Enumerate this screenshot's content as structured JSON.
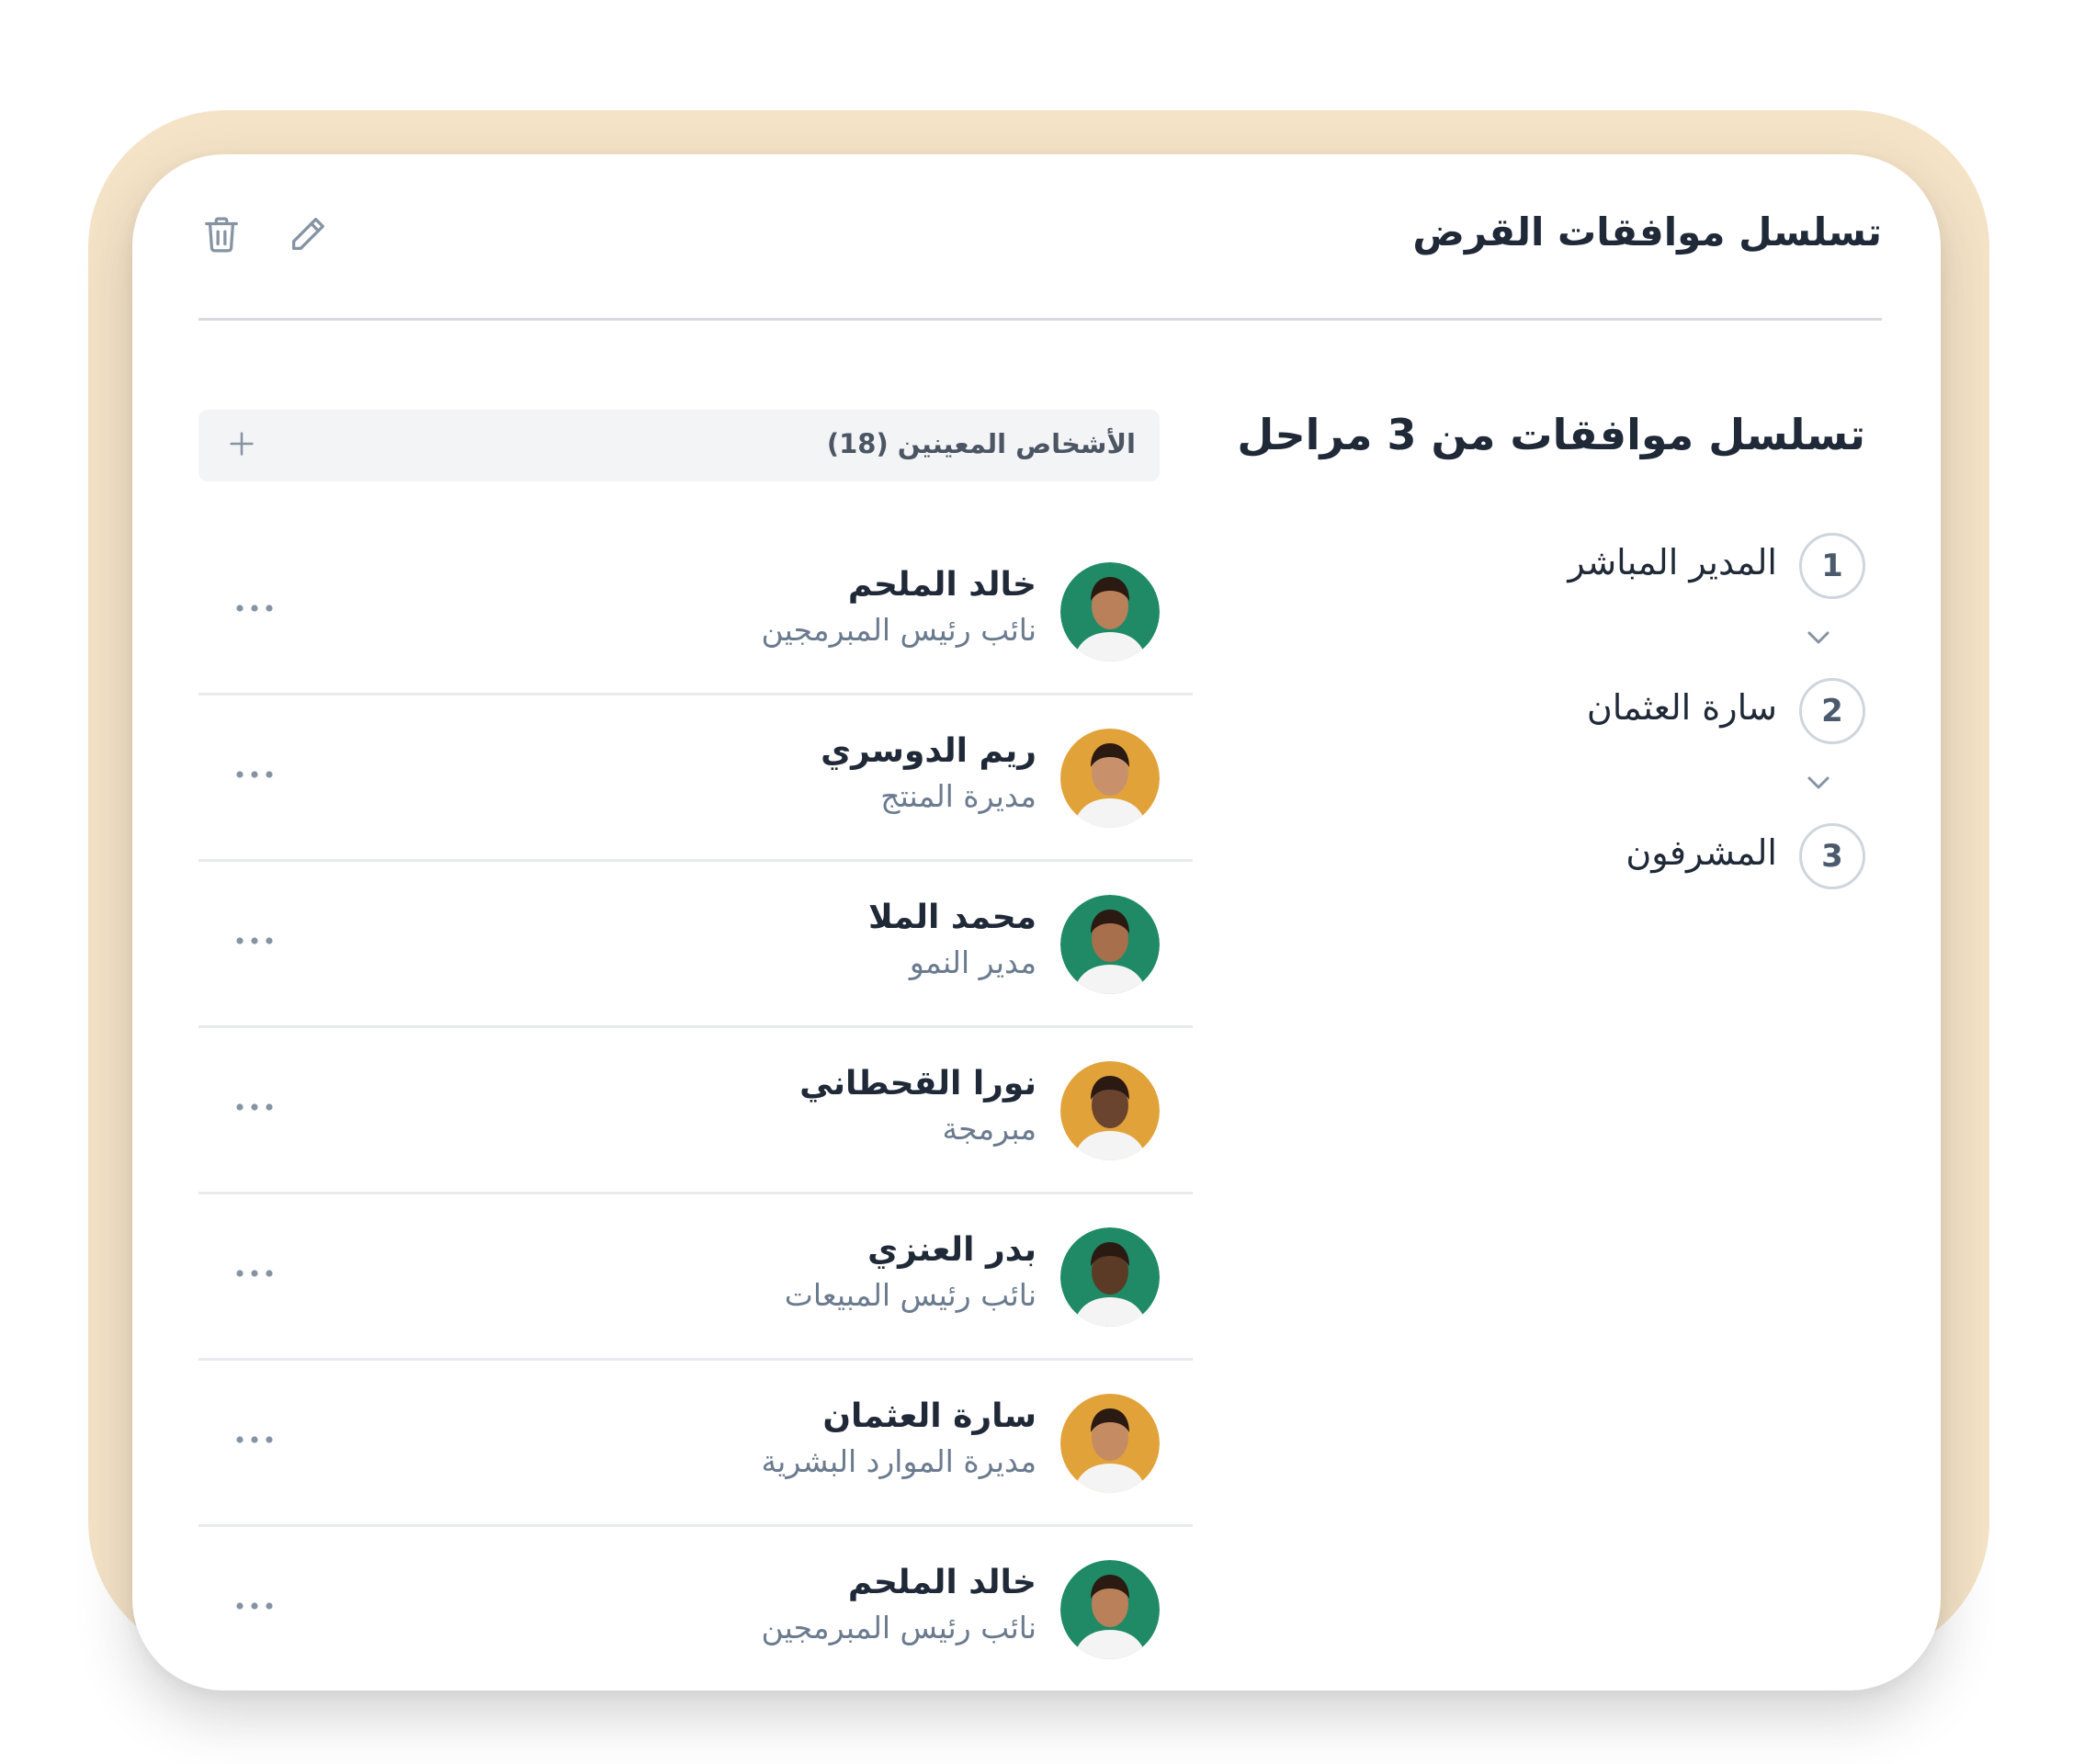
{
  "header": {
    "title": "تسلسل موافقات القرض",
    "delete_icon": "trash-icon",
    "edit_icon": "pencil-icon"
  },
  "assigned": {
    "label": "الأشخاص المعينين (18)",
    "add_icon": "plus-icon"
  },
  "people": [
    {
      "name": "خالد الملحم",
      "role": "نائب رئيس المبرمجين",
      "avatar_bg": "#1f8a65",
      "more_icon": "more-horizontal-icon"
    },
    {
      "name": "ريم الدوسري",
      "role": "مديرة المنتج",
      "avatar_bg": "#e2a23a",
      "more_icon": "more-horizontal-icon"
    },
    {
      "name": "محمد الملا",
      "role": "مدير النمو",
      "avatar_bg": "#1f8a65",
      "more_icon": "more-horizontal-icon"
    },
    {
      "name": "نورا القحطاني",
      "role": "مبرمجة",
      "avatar_bg": "#e2a23a",
      "more_icon": "more-horizontal-icon"
    },
    {
      "name": "بدر العنزي",
      "role": "نائب رئيس المبيعات",
      "avatar_bg": "#1f8a65",
      "more_icon": "more-horizontal-icon"
    },
    {
      "name": "سارة العثمان",
      "role": "مديرة الموارد البشرية",
      "avatar_bg": "#e2a23a",
      "more_icon": "more-horizontal-icon"
    },
    {
      "name": "خالد الملحم",
      "role": "نائب رئيس المبرمجين",
      "avatar_bg": "#1f8a65",
      "more_icon": "more-horizontal-icon"
    }
  ],
  "flow": {
    "title": "تسلسل موافقات من 3 مراحل",
    "steps": [
      {
        "number": "1",
        "label": "المدير المباشر"
      },
      {
        "number": "2",
        "label": "سارة العثمان"
      },
      {
        "number": "3",
        "label": "المشرفون"
      }
    ],
    "arrow_icon": "chevron-down-icon"
  },
  "colors": {
    "frame": "#f5e3c7",
    "card": "#ffffff",
    "green_avatar": "#1f8a65",
    "orange_avatar": "#e2a23a"
  }
}
